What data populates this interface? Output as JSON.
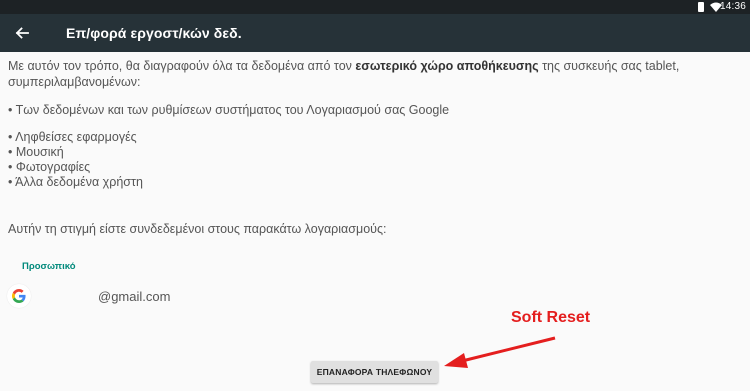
{
  "status_bar": {
    "time": "14:36",
    "icons": [
      "wifi-icon",
      "battery-icon"
    ]
  },
  "app_bar": {
    "title": "Επ/φορά εργοστ/κών δεδ.",
    "back_icon": "arrow-back-icon"
  },
  "content": {
    "intro_prefix": "Με αυτόν τον τρόπο, θα διαγραφούν όλα τα δεδομένα από τον ",
    "intro_bold": "εσωτερικό χώρο αποθήκευσης",
    "intro_suffix": " της συσκευής σας tablet,",
    "intro_line2": "συμπεριλαμβανομένων:",
    "bullet_account": "• Των δεδομένων και των ρυθμίσεων συστήματος του Λογαριασμού σας Google",
    "bullets": [
      "• Ληφθείσες εφαρμογές",
      "• Μουσική",
      "• Φωτογραφίες",
      "• Άλλα δεδομένα χρήστη"
    ],
    "accounts_intro": "Αυτήν τη στιγμή είστε συνδεδεμένοι στους παρακάτω λογαριασμούς:"
  },
  "account": {
    "label": "Προσωπικό",
    "email": "@gmail.com",
    "icon": "google-icon"
  },
  "reset_button": {
    "label": "ΕΠΑΝΑΦΟΡΑ ΤΗΛΕΦΩΝΟΥ"
  },
  "annotation": {
    "label": "Soft Reset",
    "color": "#e41e1e"
  },
  "colors": {
    "app_bar": "#263238",
    "status_bar": "#1d2225",
    "accent": "#00897b",
    "background": "#fafafa"
  }
}
